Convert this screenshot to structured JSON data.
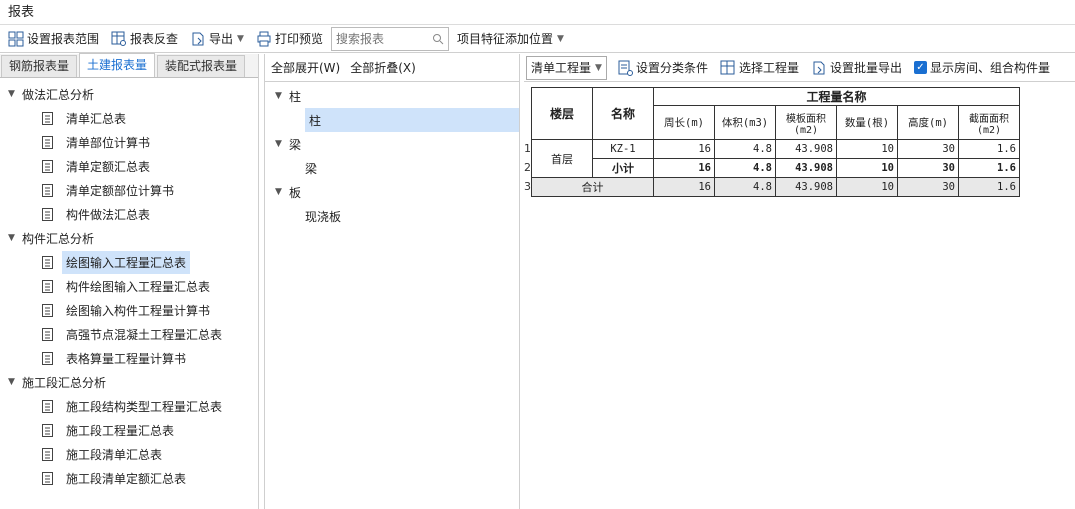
{
  "title": "报表",
  "toolbar": {
    "set_range": "设置报表范围",
    "reverse": "报表反查",
    "export": "导出",
    "print_preview": "打印预览",
    "search_placeholder": "搜索报表",
    "feature_position": "项目特征添加位置"
  },
  "tabs": [
    "钢筋报表量",
    "土建报表量",
    "装配式报表量"
  ],
  "left_tree": [
    {
      "label": "做法汇总分析",
      "items": [
        "清单汇总表",
        "清单部位计算书",
        "清单定额汇总表",
        "清单定额部位计算书",
        "构件做法汇总表"
      ]
    },
    {
      "label": "构件汇总分析",
      "items": [
        "绘图输入工程量汇总表",
        "构件绘图输入工程量汇总表",
        "绘图输入构件工程量计算书",
        "高强节点混凝土工程量汇总表",
        "表格算量工程量计算书"
      ]
    },
    {
      "label": "施工段汇总分析",
      "items": [
        "施工段结构类型工程量汇总表",
        "施工段工程量汇总表",
        "施工段清单汇总表",
        "施工段清单定额汇总表"
      ]
    }
  ],
  "mid": {
    "expand_all": "全部展开(W)",
    "collapse_all": "全部折叠(X)",
    "groups": [
      {
        "label": "柱",
        "item": "柱"
      },
      {
        "label": "梁",
        "item": "梁"
      },
      {
        "label": "板",
        "item": "现浇板"
      }
    ]
  },
  "right_toolbar": {
    "select_value": "清单工程量",
    "set_category": "设置分类条件",
    "select_quantity": "选择工程量",
    "batch_export": "设置批量导出",
    "show_rooms": "显示房间、组合构件量"
  },
  "table": {
    "header_floor": "楼层",
    "header_name": "名称",
    "header_group": "工程量名称",
    "columns": [
      "周长(m)",
      "体积(m3)",
      "模板面积(m2)",
      "数量(根)",
      "高度(m)",
      "截面面积(m2)"
    ],
    "floor": "首层",
    "row1": {
      "num": "1",
      "name": "KZ-1",
      "values": [
        "16",
        "4.8",
        "43.908",
        "10",
        "30",
        "1.6"
      ]
    },
    "row2": {
      "num": "2",
      "name": "小计",
      "values": [
        "16",
        "4.8",
        "43.908",
        "10",
        "30",
        "1.6"
      ]
    },
    "row3": {
      "num": "3",
      "name": "合计",
      "values": [
        "16",
        "4.8",
        "43.908",
        "10",
        "30",
        "1.6"
      ]
    }
  }
}
